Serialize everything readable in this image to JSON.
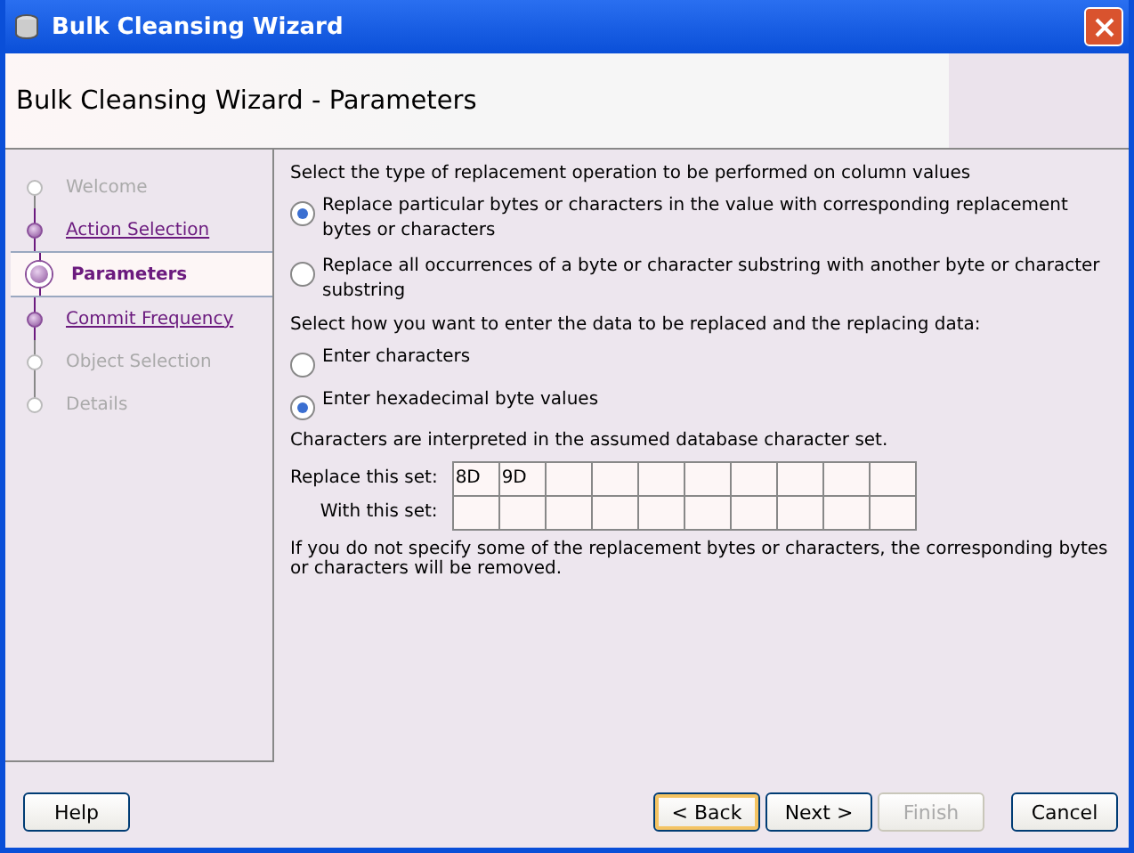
{
  "window": {
    "title": "Bulk Cleansing Wizard"
  },
  "header": {
    "title": "Bulk Cleansing Wizard - Parameters"
  },
  "steps": [
    {
      "label": "Welcome",
      "kind": "pending"
    },
    {
      "label": "Action Selection",
      "kind": "visited"
    },
    {
      "label": "Parameters",
      "kind": "current"
    },
    {
      "label": "Commit Frequency",
      "kind": "visited"
    },
    {
      "label": "Object Selection",
      "kind": "pending"
    },
    {
      "label": "Details",
      "kind": "pending"
    }
  ],
  "operation": {
    "prompt": "Select the type of replacement operation to be performed on column values",
    "options": [
      {
        "label": "Replace particular bytes or characters in the value with corresponding replacement bytes or characters",
        "selected": true
      },
      {
        "label": "Replace all occurrences of a byte or character substring with another byte or character substring",
        "selected": false
      }
    ]
  },
  "entry": {
    "prompt": "Select how you want to enter the data to be replaced and the replacing data:",
    "options": [
      {
        "label": "Enter characters",
        "selected": false
      },
      {
        "label": "Enter hexadecimal byte values",
        "selected": true
      }
    ]
  },
  "charset_note": "Characters are interpreted in the assumed database character set.",
  "sets": [
    {
      "label": "Replace this set:",
      "values": [
        "8D",
        "9D"
      ]
    },
    {
      "label": "With this set:"
    }
  ],
  "footnote": "If you do not specify some of the replacement bytes or characters, the corresponding bytes or characters will be removed.",
  "buttons": {
    "left": [
      {
        "label": "Help",
        "disabled": false,
        "default": false
      }
    ],
    "right": [
      {
        "label": "< Back",
        "disabled": false,
        "default": true
      },
      {
        "label": "Next >",
        "disabled": false,
        "default": false
      },
      {
        "label": "Finish",
        "disabled": true,
        "default": false
      },
      {
        "label": "Cancel",
        "disabled": false,
        "default": false
      }
    ]
  }
}
